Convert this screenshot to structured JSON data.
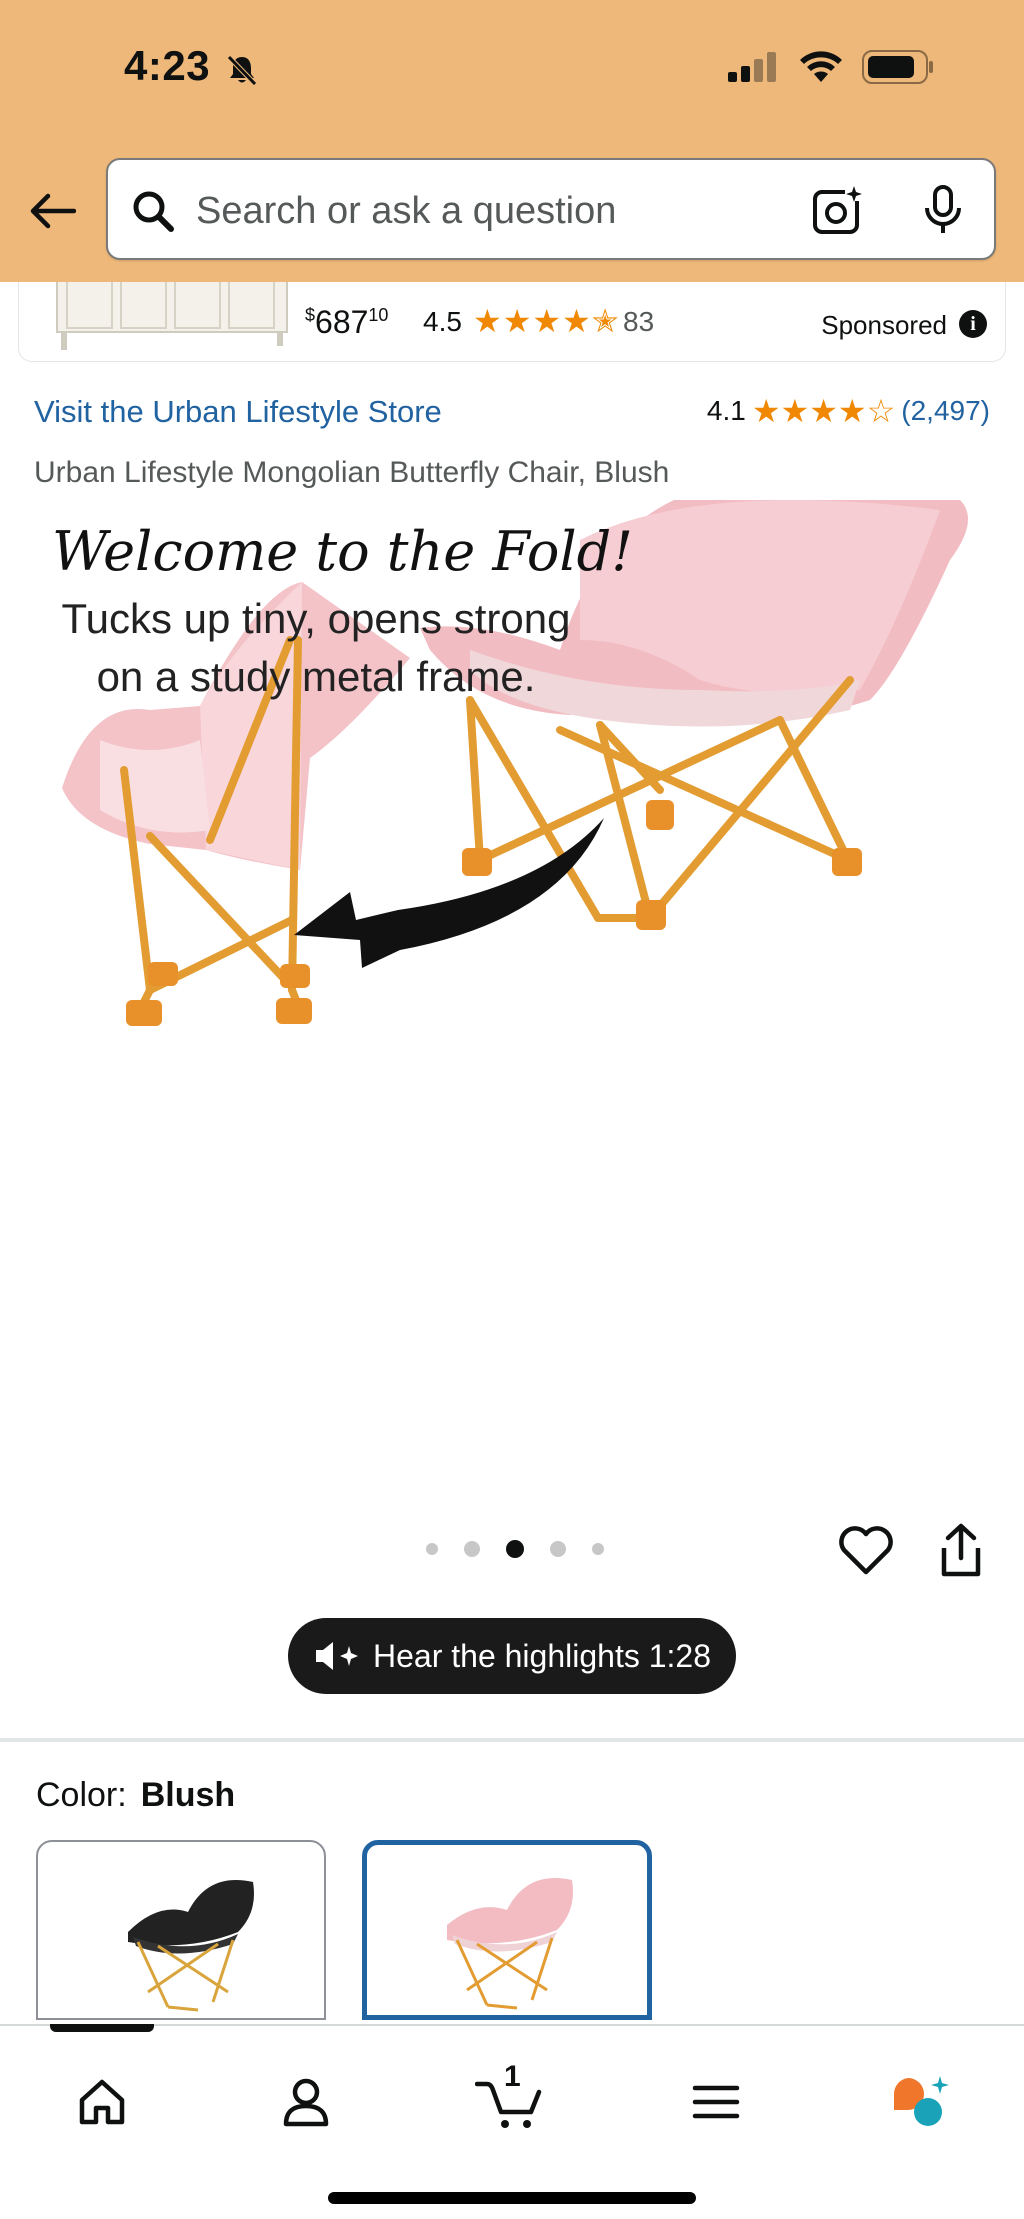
{
  "status_bar": {
    "time": "4:23"
  },
  "search": {
    "placeholder": "Search or ask a question"
  },
  "sponsored": {
    "price_symbol": "$",
    "price_whole": "687",
    "price_fraction": "10",
    "rating": "4.5",
    "rating_stars": 4.5,
    "review_count": "83",
    "label": "Sponsored"
  },
  "product": {
    "store_link": "Visit the Urban Lifestyle Store",
    "rating": "4.1",
    "rating_stars": 4.1,
    "review_count": "(2,497)",
    "title": "Urban Lifestyle Mongolian Butterfly Chair, Blush"
  },
  "hero_image": {
    "headline": "Welcome to the Fold!",
    "subtext_line1": "Tucks up tiny, opens strong",
    "subtext_line2": "on a study metal frame."
  },
  "carousel": {
    "total": 5,
    "active_index": 2
  },
  "hear_highlights": {
    "label": "Hear the highlights 1:28"
  },
  "color": {
    "label": "Color:",
    "selected": "Blush"
  },
  "swatches": [
    {
      "name": "Black",
      "selected": false
    },
    {
      "name": "Blush",
      "selected": true
    }
  ],
  "bottom_nav": {
    "cart_count": "1",
    "items": [
      "home",
      "account",
      "cart",
      "menu",
      "rufus"
    ]
  },
  "colors": {
    "header_bg": "#eeb87a",
    "link": "#2162a1",
    "star": "#f08804",
    "selected_border": "#2162a1"
  }
}
